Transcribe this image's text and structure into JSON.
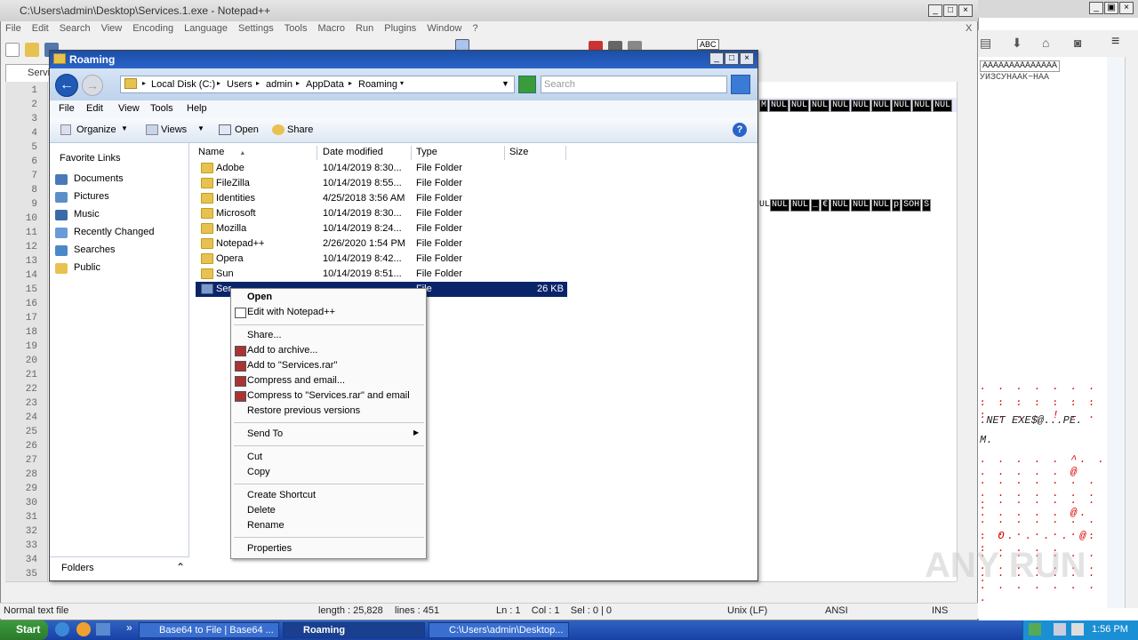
{
  "npp": {
    "title": "C:\\Users\\admin\\Desktop\\Services.1.exe - Notepad++",
    "menu": [
      "File",
      "Edit",
      "Search",
      "View",
      "Encoding",
      "Language",
      "Settings",
      "Tools",
      "Macro",
      "Run",
      "Plugins",
      "Window",
      "?"
    ],
    "close_x": "X",
    "tab": "Servic",
    "line_numbers": [
      "1",
      "2",
      "3",
      "4",
      "5",
      "6",
      "7",
      "8",
      "9",
      "10",
      "11",
      "12",
      "13",
      "14",
      "15",
      "16",
      "17",
      "18",
      "19",
      "20",
      "21",
      "22",
      "23",
      "24",
      "25",
      "26",
      "27",
      "28",
      "29",
      "30",
      "31",
      "32",
      "33",
      "34",
      "35"
    ],
    "nul_row_1": [
      "M",
      "NUL",
      "NUL",
      "NUL",
      "NUL",
      "NUL",
      "NUL",
      "NUL",
      "NUL",
      "NUL"
    ],
    "nul_row_2_prefix": "UL",
    "nul_row_2": [
      "NUL",
      "NUL",
      "_",
      "€",
      "NUL",
      "NUL",
      "NUL",
      "p",
      "SOH",
      "S"
    ],
    "status": {
      "filetype": "Normal text file",
      "length": "length : 25,828",
      "lines": "lines : 451",
      "pos": "Ln : 1    Col : 1    Sel : 0 | 0",
      "eol": "Unix (LF)",
      "encoding": "ANSI",
      "mode": "INS"
    },
    "toolbar_abc": "ABC"
  },
  "right": {
    "top_text": "AAAAAAAAAAAAAA",
    "top_text2": "УИЗСУНААК~НАА",
    "hex_rows": [
      {
        "text": ". . . . . . . . . . . . . . .",
        "dots": true
      },
      {
        "text": ". . . . . . . . . . . ! . .",
        "dots": true
      },
      {
        "text": ".NET EXE$@...PE.",
        "dots": false
      },
      {
        "text": "M.",
        "dots": false
      },
      {
        "text": ". . . . . ^. . . .  . . . @",
        "dots": true
      },
      {
        "text": ". . . . . . . . . . . . . . .",
        "dots": true
      },
      {
        "text": ". . . . . . . . . . . . @.",
        "dots": true
      },
      {
        "text": ". . . . . . . . . . . . . . .",
        "dots": true
      },
      {
        "text": ". O. . . . @. . . . . .",
        "dots": true
      },
      {
        "text": ". . . . . . . . . . . . . . .",
        "dots": true
      },
      {
        "text": ". . . . . . . . . . . . . . .",
        "dots": true
      }
    ]
  },
  "explorer": {
    "title": "Roaming",
    "breadcrumb": [
      "Local Disk (C:)",
      "Users",
      "admin",
      "AppData",
      "Roaming"
    ],
    "search_placeholder": "Search",
    "menu": [
      "File",
      "Edit",
      "View",
      "Tools",
      "Help"
    ],
    "commands": {
      "organize": "Organize",
      "views": "Views",
      "open": "Open",
      "share": "Share"
    },
    "favorites_header": "Favorite Links",
    "favorites": [
      {
        "label": "Documents",
        "color": "#4a79b8"
      },
      {
        "label": "Pictures",
        "color": "#5b8fc8"
      },
      {
        "label": "Music",
        "color": "#3a6aa8"
      },
      {
        "label": "Recently Changed",
        "color": "#6a9ad8"
      },
      {
        "label": "Searches",
        "color": "#4a88c8"
      },
      {
        "label": "Public",
        "color": "#e8c250"
      }
    ],
    "folders_label": "Folders",
    "columns": [
      "Name",
      "Date modified",
      "Type",
      "Size"
    ],
    "files": [
      {
        "name": "Adobe",
        "date": "10/14/2019 8:30...",
        "type": "File Folder",
        "size": ""
      },
      {
        "name": "FileZilla",
        "date": "10/14/2019 8:55...",
        "type": "File Folder",
        "size": ""
      },
      {
        "name": "Identities",
        "date": "4/25/2018 3:56 AM",
        "type": "File Folder",
        "size": ""
      },
      {
        "name": "Microsoft",
        "date": "10/14/2019 8:30...",
        "type": "File Folder",
        "size": ""
      },
      {
        "name": "Mozilla",
        "date": "10/14/2019 8:24...",
        "type": "File Folder",
        "size": ""
      },
      {
        "name": "Notepad++",
        "date": "2/26/2020 1:54 PM",
        "type": "File Folder",
        "size": ""
      },
      {
        "name": "Opera",
        "date": "10/14/2019 8:42...",
        "type": "File Folder",
        "size": ""
      },
      {
        "name": "Sun",
        "date": "10/14/2019 8:51...",
        "type": "File Folder",
        "size": ""
      },
      {
        "name": "Ser",
        "date": "",
        "type": "File",
        "size": "26 KB"
      }
    ]
  },
  "context_menu": {
    "open": "Open",
    "edit_npp": "Edit with Notepad++",
    "share": "Share...",
    "add_archive": "Add to archive...",
    "add_rar": "Add to \"Services.rar\"",
    "compress_email": "Compress and email...",
    "compress_rar_email": "Compress to \"Services.rar\" and email",
    "restore": "Restore previous versions",
    "send_to": "Send To",
    "cut": "Cut",
    "copy": "Copy",
    "create_shortcut": "Create Shortcut",
    "delete": "Delete",
    "rename": "Rename",
    "properties": "Properties"
  },
  "taskbar": {
    "start": "Start",
    "tasks": [
      "Base64 to File | Base64 ...",
      "Roaming",
      "C:\\Users\\admin\\Desktop..."
    ],
    "clock": "1:56 PM"
  },
  "watermark": "ANY RUN"
}
